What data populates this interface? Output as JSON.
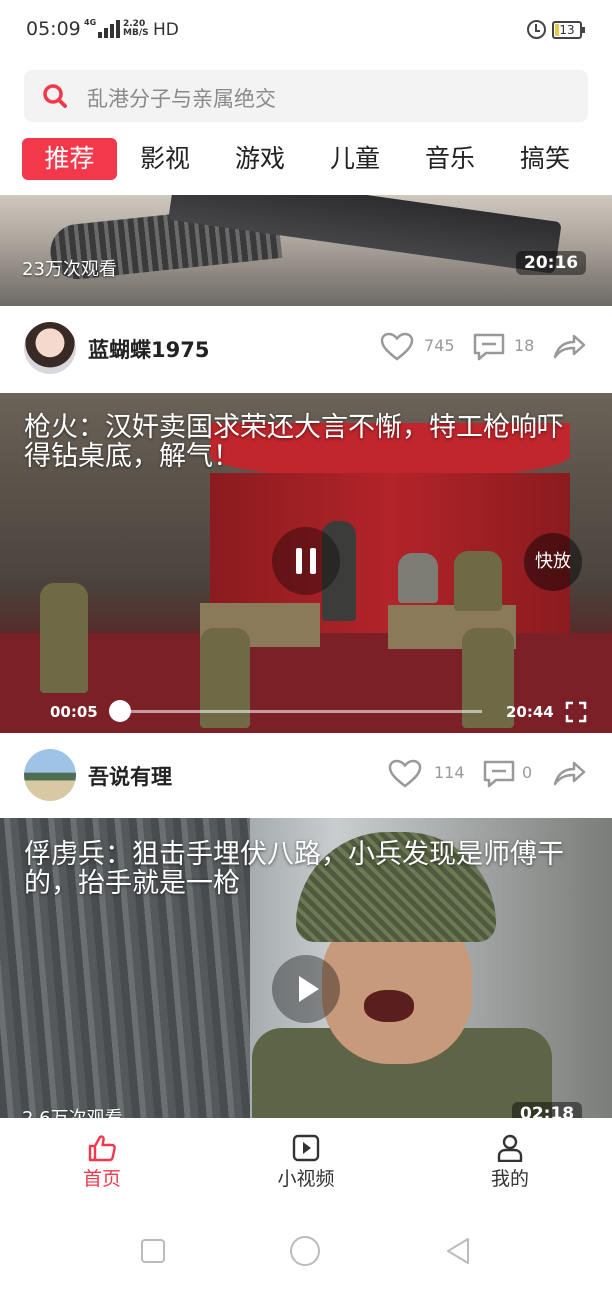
{
  "status_bar": {
    "time": "05:09",
    "network": "4G",
    "speed_value": "2.20",
    "speed_unit": "MB/S",
    "hd": "HD",
    "battery": "13"
  },
  "search": {
    "placeholder": "乱港分子与亲属绝交"
  },
  "tabs": [
    {
      "label": "推荐",
      "active": true
    },
    {
      "label": "影视"
    },
    {
      "label": "游戏"
    },
    {
      "label": "儿童"
    },
    {
      "label": "音乐"
    },
    {
      "label": "搞笑"
    }
  ],
  "feed": [
    {
      "views": "23万次观看",
      "duration": "20:16",
      "author": "蓝蝴蝶1975",
      "likes": "745",
      "comments": "18"
    },
    {
      "title": "枪火：汉奸卖国求荣还大言不惭，特工枪响吓得钻桌底，解气！",
      "current_time": "00:05",
      "total_time": "20:44",
      "progress": 0.0,
      "speed_button": "快放",
      "author": "吾说有理",
      "likes": "114",
      "comments": "0"
    },
    {
      "title": "俘虏兵：狙击手埋伏八路，小兵发现是师傅干的，抬手就是一枪",
      "views": "2.6万次观看",
      "duration": "02:18"
    }
  ],
  "bottom_nav": [
    {
      "label": "首页",
      "icon": "thumbs-up-icon",
      "active": true
    },
    {
      "label": "小视频",
      "icon": "play-square-icon"
    },
    {
      "label": "我的",
      "icon": "user-icon"
    }
  ],
  "colors": {
    "accent": "#f2384a"
  }
}
